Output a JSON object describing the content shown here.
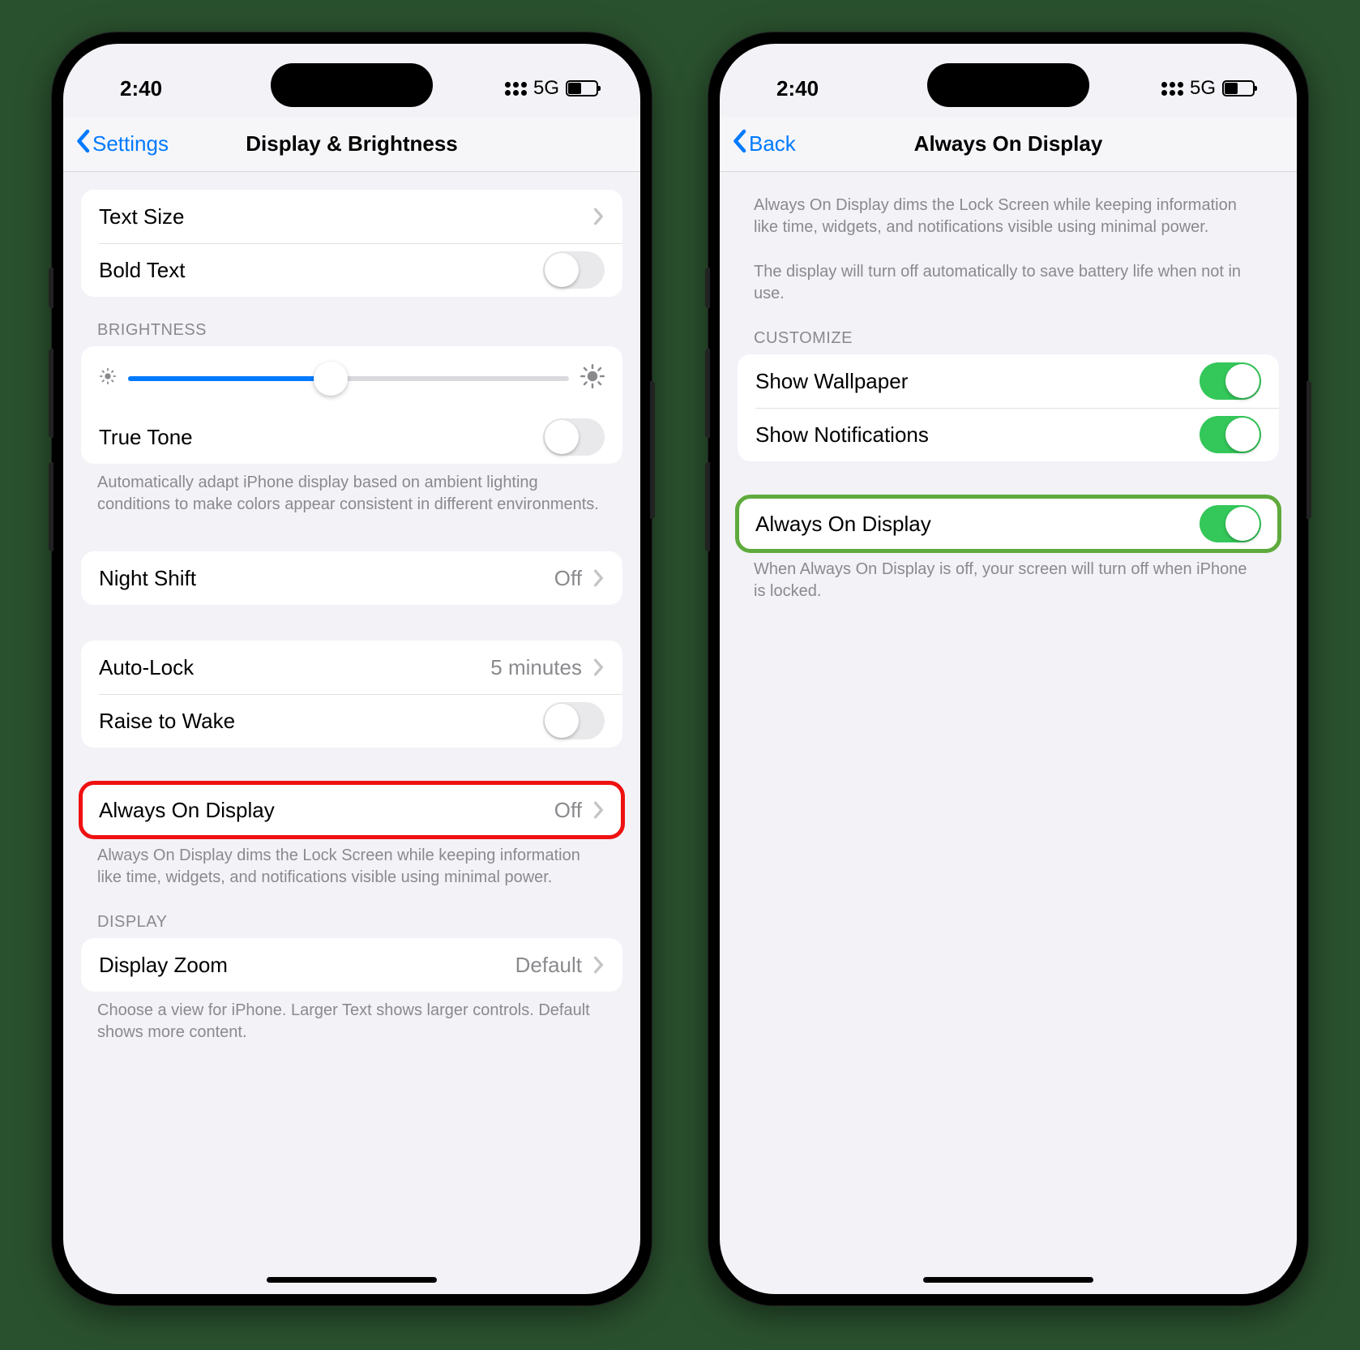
{
  "status": {
    "time": "2:40",
    "network": "5G"
  },
  "left": {
    "back": "Settings",
    "title": "Display & Brightness",
    "text_size": "Text Size",
    "bold_text": "Bold Text",
    "bold_text_on": false,
    "brightness_header": "BRIGHTNESS",
    "brightness_value": 0.46,
    "true_tone": "True Tone",
    "true_tone_on": false,
    "true_tone_footer": "Automatically adapt iPhone display based on ambient lighting conditions to make colors appear consistent in different environments.",
    "night_shift": "Night Shift",
    "night_shift_value": "Off",
    "auto_lock": "Auto-Lock",
    "auto_lock_value": "5 minutes",
    "raise_to_wake": "Raise to Wake",
    "raise_to_wake_on": false,
    "aod": "Always On Display",
    "aod_value": "Off",
    "aod_footer": "Always On Display dims the Lock Screen while keeping information like time, widgets, and notifications visible using minimal power.",
    "display_header": "DISPLAY",
    "display_zoom": "Display Zoom",
    "display_zoom_value": "Default",
    "display_zoom_footer": "Choose a view for iPhone. Larger Text shows larger controls. Default shows more content."
  },
  "right": {
    "back": "Back",
    "title": "Always On Display",
    "intro1": "Always On Display dims the Lock Screen while keeping information like time, widgets, and notifications visible using minimal power.",
    "intro2": "The display will turn off automatically to save battery life when not in use.",
    "customize_header": "CUSTOMIZE",
    "show_wallpaper": "Show Wallpaper",
    "show_wallpaper_on": true,
    "show_notifications": "Show Notifications",
    "show_notifications_on": true,
    "aod": "Always On Display",
    "aod_on": true,
    "aod_footer": "When Always On Display is off, your screen will turn off when iPhone is locked."
  }
}
